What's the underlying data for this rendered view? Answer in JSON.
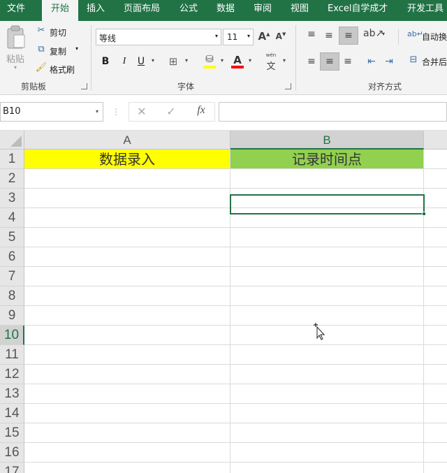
{
  "ribbon_tabs": [
    {
      "label": "文件"
    },
    {
      "label": "开始"
    },
    {
      "label": "插入"
    },
    {
      "label": "页面布局"
    },
    {
      "label": "公式"
    },
    {
      "label": "数据"
    },
    {
      "label": "审阅"
    },
    {
      "label": "视图"
    },
    {
      "label": "Excel自学成才"
    },
    {
      "label": "开发工具"
    }
  ],
  "active_tab": "开始",
  "clipboard": {
    "paste_label": "粘贴",
    "cut_label": "剪切",
    "copy_label": "复制",
    "format_painter_label": "格式刷",
    "group_label": "剪贴板"
  },
  "font": {
    "font_name": "等线",
    "font_size": "11",
    "bold": "B",
    "italic": "I",
    "underline": "U",
    "increase_size": "A",
    "decrease_size": "A",
    "font_color_letter": "A",
    "phonetic": "wén",
    "phonetic_char": "文",
    "group_label": "字体"
  },
  "alignment": {
    "wrap_text_label": "自动换行",
    "merge_center_label": "合并后居中",
    "group_label": "对齐方式"
  },
  "formula_bar": {
    "name_box": "B10",
    "cancel_glyph": "✕",
    "enter_glyph": "✓",
    "fx_label": "fx",
    "formula": ""
  },
  "sheet": {
    "columns": [
      "A",
      "B"
    ],
    "rows": [
      "1",
      "2",
      "3",
      "4",
      "5",
      "6",
      "7",
      "8",
      "9",
      "10",
      "11",
      "12",
      "13",
      "14",
      "15",
      "16",
      "17"
    ],
    "cells": {
      "A1": "数据录入",
      "B1": "记录时间点"
    },
    "selected_cell": "B10",
    "colors": {
      "a1_fill": "#ffff00",
      "b1_fill": "#92d050",
      "accent": "#217346"
    }
  }
}
